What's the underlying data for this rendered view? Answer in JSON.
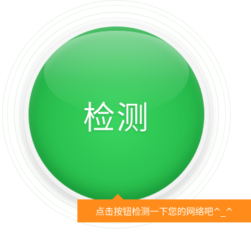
{
  "detect_button": {
    "label": "检测",
    "color": "#2cc351"
  },
  "hint": {
    "text": "点击按钮检测一下您的网络吧^_^",
    "color": "#ff8c1a"
  }
}
